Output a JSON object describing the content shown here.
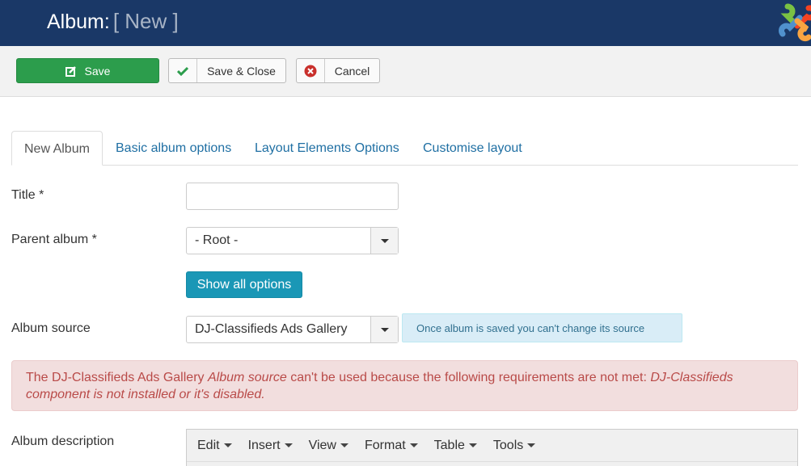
{
  "header": {
    "title": "Album:",
    "subtitle": "[ New ]",
    "logo_icon": "joomla-logo-icon"
  },
  "toolbar": {
    "save_label": "Save",
    "save_icon": "edit-icon",
    "save_close_label": "Save & Close",
    "save_close_icon": "check-icon",
    "cancel_label": "Cancel",
    "cancel_icon": "cancel-circle-icon"
  },
  "tabs": [
    {
      "label": "New Album",
      "active": true
    },
    {
      "label": "Basic album options",
      "active": false
    },
    {
      "label": "Layout Elements Options",
      "active": false
    },
    {
      "label": "Customise layout",
      "active": false
    }
  ],
  "form": {
    "title_label": "Title *",
    "title_value": "",
    "parent_label": "Parent album *",
    "parent_value": "- Root -",
    "show_all_label": "Show all options",
    "source_label": "Album source",
    "source_value": "DJ-Classifieds Ads Gallery",
    "source_info": "Once album is saved you can't change its source",
    "description_label": "Album description"
  },
  "alert": {
    "part1": "The DJ-Classifieds Ads Gallery ",
    "part2": "Album source",
    "part3": " can't be used because the following requirements are not met: ",
    "part4": "DJ-Classifieds component is not installed or it's disabled."
  },
  "editor": {
    "menus": [
      "Edit",
      "Insert",
      "View",
      "Format",
      "Table",
      "Tools"
    ]
  },
  "colors": {
    "header_bg": "#1a3867",
    "save_green": "#2c9d4c",
    "show_all_blue": "#1a97b6",
    "alert_red": "#b94a48",
    "link_blue": "#1f6fa3"
  }
}
